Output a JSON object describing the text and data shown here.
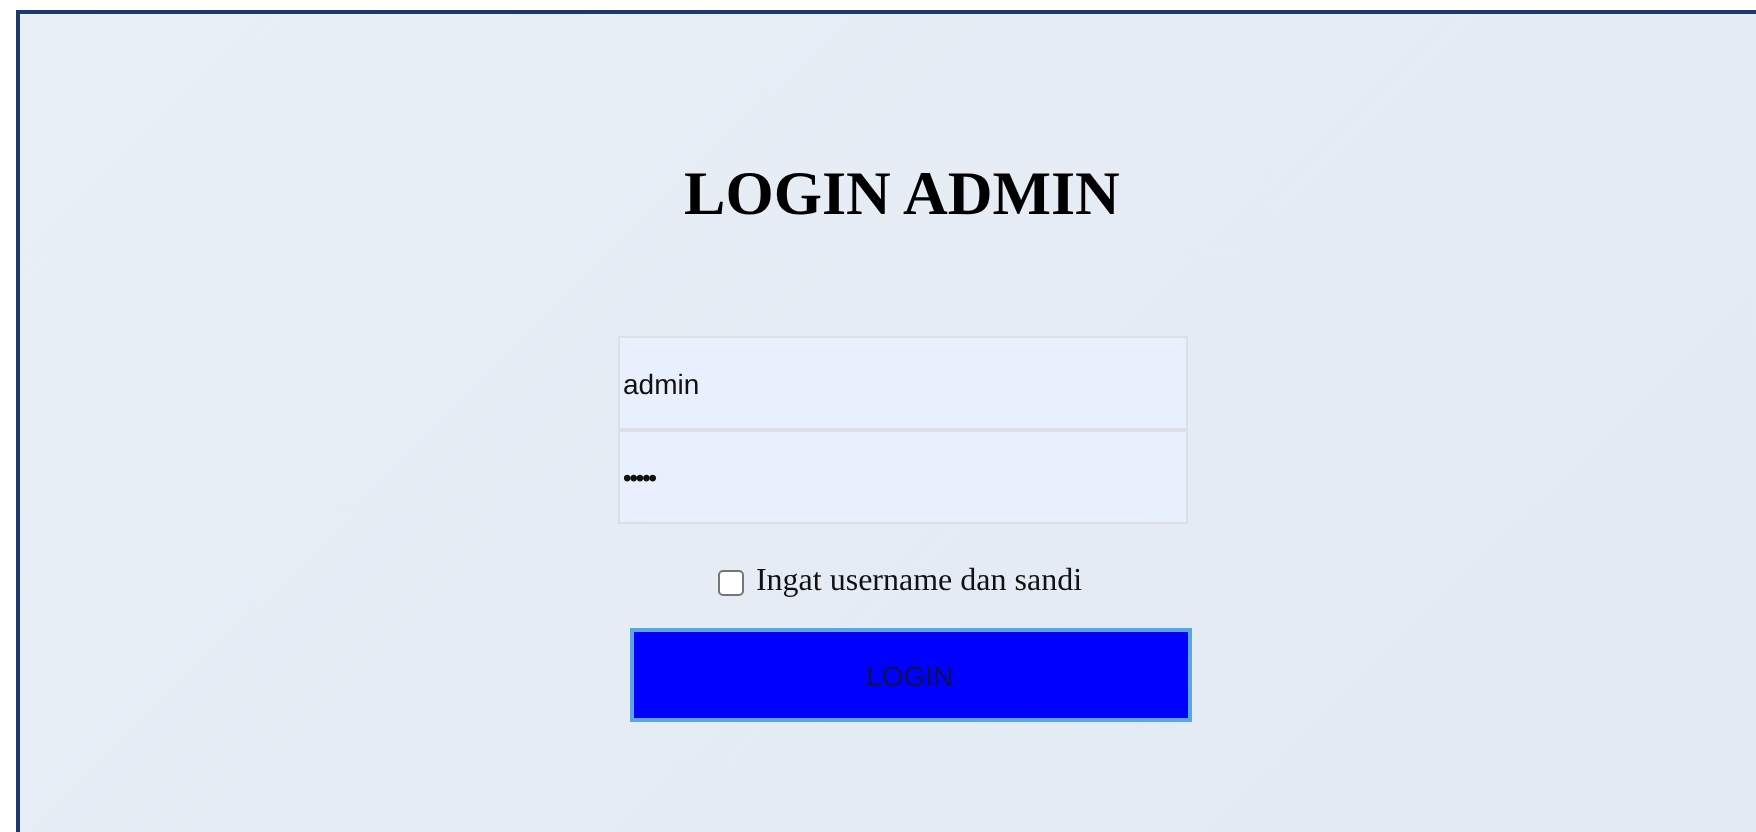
{
  "title": "LOGIN ADMIN",
  "fields": [
    {
      "kind": "text",
      "value": "admin"
    },
    {
      "kind": "password",
      "value": "•••••"
    }
  ],
  "remember": {
    "label": "Ingat username dan sandi",
    "checked": false
  },
  "button": {
    "label": "LOGIN"
  }
}
